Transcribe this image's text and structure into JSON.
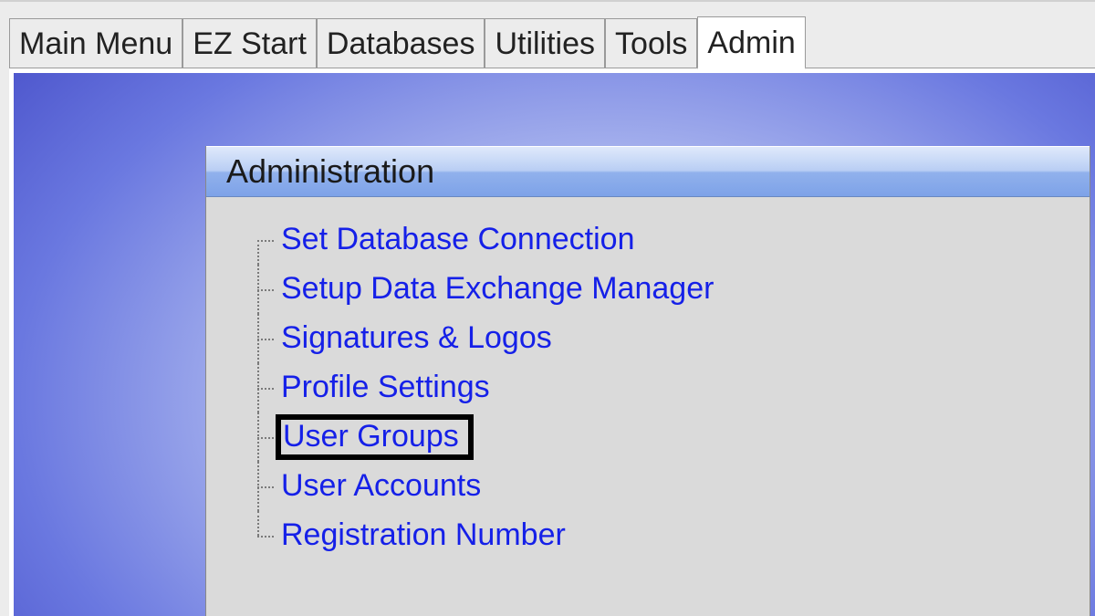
{
  "tabs": [
    {
      "label": "Main Menu",
      "active": false
    },
    {
      "label": "EZ Start",
      "active": false
    },
    {
      "label": "Databases",
      "active": false
    },
    {
      "label": "Utilities",
      "active": false
    },
    {
      "label": "Tools",
      "active": false
    },
    {
      "label": "Admin",
      "active": true
    }
  ],
  "panel": {
    "title": "Administration",
    "items": [
      {
        "label": "Set Database Connection",
        "highlight": false
      },
      {
        "label": "Setup Data Exchange Manager",
        "highlight": false
      },
      {
        "label": "Signatures & Logos",
        "highlight": false
      },
      {
        "label": "Profile Settings",
        "highlight": false
      },
      {
        "label": "User Groups",
        "highlight": true
      },
      {
        "label": "User Accounts",
        "highlight": false
      },
      {
        "label": "Registration Number",
        "highlight": false
      }
    ]
  }
}
